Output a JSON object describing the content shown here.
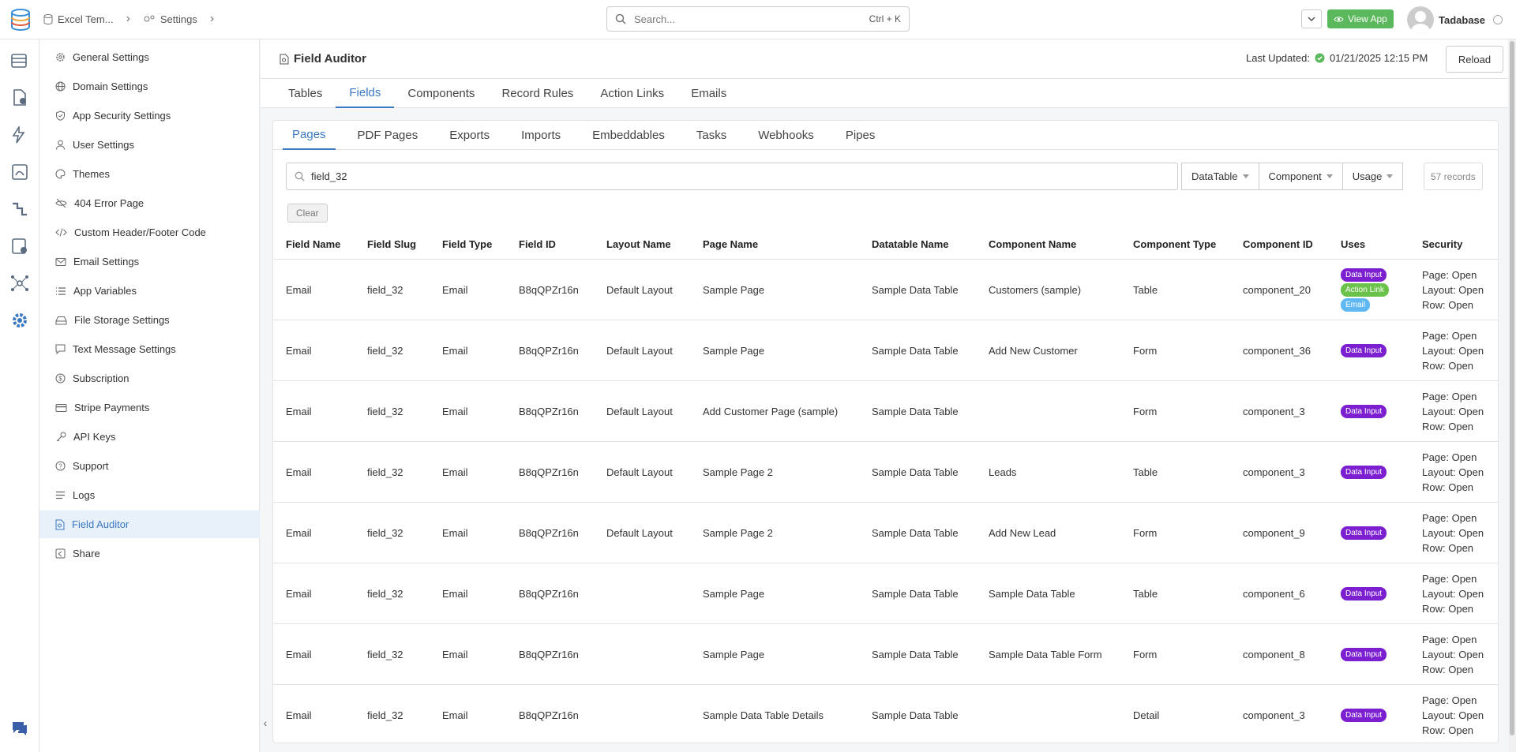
{
  "topbar": {
    "crumbs": [
      {
        "label": "Excel Tem..."
      },
      {
        "label": "Settings"
      }
    ],
    "search_placeholder": "Search...",
    "search_shortcut": "Ctrl + K",
    "view_app": "View App",
    "user_name": "Tadabase"
  },
  "sidebar": {
    "items": [
      {
        "label": "General Settings",
        "icon": "gear-icon"
      },
      {
        "label": "Domain Settings",
        "icon": "globe-icon"
      },
      {
        "label": "App Security Settings",
        "icon": "shield-icon"
      },
      {
        "label": "User Settings",
        "icon": "user-icon"
      },
      {
        "label": "Themes",
        "icon": "palette-icon"
      },
      {
        "label": "404 Error Page",
        "icon": "eye-slash-icon"
      },
      {
        "label": "Custom Header/Footer Code",
        "icon": "code-icon"
      },
      {
        "label": "Email Settings",
        "icon": "envelope-icon"
      },
      {
        "label": "App Variables",
        "icon": "list-icon"
      },
      {
        "label": "File Storage Settings",
        "icon": "hard-drive-icon"
      },
      {
        "label": "Text Message Settings",
        "icon": "chat-icon"
      },
      {
        "label": "Subscription",
        "icon": "dollar-icon"
      },
      {
        "label": "Stripe Payments",
        "icon": "credit-card-icon"
      },
      {
        "label": "API Keys",
        "icon": "key-icon"
      },
      {
        "label": "Support",
        "icon": "question-icon"
      },
      {
        "label": "Logs",
        "icon": "lines-icon"
      },
      {
        "label": "Field Auditor",
        "icon": "file-search-icon"
      },
      {
        "label": "Share",
        "icon": "share-icon"
      }
    ]
  },
  "header": {
    "title": "Field Auditor",
    "last_updated_label": "Last Updated:",
    "last_updated_value": "01/21/2025 12:15 PM",
    "reload": "Reload"
  },
  "tabs_primary": [
    "Tables",
    "Fields",
    "Components",
    "Record Rules",
    "Action Links",
    "Emails"
  ],
  "tabs_secondary": [
    "Pages",
    "PDF Pages",
    "Exports",
    "Imports",
    "Embeddables",
    "Tasks",
    "Webhooks",
    "Pipes"
  ],
  "filters": {
    "search_value": "field_32",
    "datatable": "DataTable",
    "component": "Component",
    "usage": "Usage",
    "records": "57 records",
    "clear": "Clear"
  },
  "table": {
    "columns": [
      "Field Name",
      "Field Slug",
      "Field Type",
      "Field ID",
      "Layout Name",
      "Page Name",
      "Datatable Name",
      "Component Name",
      "Component Type",
      "Component ID",
      "Uses",
      "Security"
    ],
    "rows": [
      {
        "field_name": "Email",
        "field_slug": "field_32",
        "field_type": "Email",
        "field_id": "B8qQPZr16n",
        "layout": "Default Layout",
        "page": "Sample Page",
        "datatable": "Sample Data Table",
        "component": "Customers (sample)",
        "comp_type": "Table",
        "comp_id": "component_20",
        "uses": [
          "Data Input",
          "Action Link",
          "Email"
        ],
        "sec": [
          "Page: Open",
          "Layout: Open",
          "Row: Open"
        ]
      },
      {
        "field_name": "Email",
        "field_slug": "field_32",
        "field_type": "Email",
        "field_id": "B8qQPZr16n",
        "layout": "Default Layout",
        "page": "Sample Page",
        "datatable": "Sample Data Table",
        "component": "Add New Customer",
        "comp_type": "Form",
        "comp_id": "component_36",
        "uses": [
          "Data Input"
        ],
        "sec": [
          "Page: Open",
          "Layout: Open",
          "Row: Open"
        ]
      },
      {
        "field_name": "Email",
        "field_slug": "field_32",
        "field_type": "Email",
        "field_id": "B8qQPZr16n",
        "layout": "Default Layout",
        "page": "Add Customer Page (sample)",
        "datatable": "Sample Data Table",
        "component": "",
        "comp_type": "Form",
        "comp_id": "component_3",
        "uses": [
          "Data Input"
        ],
        "sec": [
          "Page: Open",
          "Layout: Open",
          "Row: Open"
        ]
      },
      {
        "field_name": "Email",
        "field_slug": "field_32",
        "field_type": "Email",
        "field_id": "B8qQPZr16n",
        "layout": "Default Layout",
        "page": "Sample Page 2",
        "datatable": "Sample Data Table",
        "component": "Leads",
        "comp_type": "Table",
        "comp_id": "component_3",
        "uses": [
          "Data Input"
        ],
        "sec": [
          "Page: Open",
          "Layout: Open",
          "Row: Open"
        ]
      },
      {
        "field_name": "Email",
        "field_slug": "field_32",
        "field_type": "Email",
        "field_id": "B8qQPZr16n",
        "layout": "Default Layout",
        "page": "Sample Page 2",
        "datatable": "Sample Data Table",
        "component": "Add New Lead",
        "comp_type": "Form",
        "comp_id": "component_9",
        "uses": [
          "Data Input"
        ],
        "sec": [
          "Page: Open",
          "Layout: Open",
          "Row: Open"
        ]
      },
      {
        "field_name": "Email",
        "field_slug": "field_32",
        "field_type": "Email",
        "field_id": "B8qQPZr16n",
        "layout": "",
        "page": "Sample Page",
        "datatable": "Sample Data Table",
        "component": "Sample Data Table",
        "comp_type": "Table",
        "comp_id": "component_6",
        "uses": [
          "Data Input"
        ],
        "sec": [
          "Page: Open",
          "Layout: Open",
          "Row: Open"
        ]
      },
      {
        "field_name": "Email",
        "field_slug": "field_32",
        "field_type": "Email",
        "field_id": "B8qQPZr16n",
        "layout": "",
        "page": "Sample Page",
        "datatable": "Sample Data Table",
        "component": "Sample Data Table Form",
        "comp_type": "Form",
        "comp_id": "component_8",
        "uses": [
          "Data Input"
        ],
        "sec": [
          "Page: Open",
          "Layout: Open",
          "Row: Open"
        ]
      },
      {
        "field_name": "Email",
        "field_slug": "field_32",
        "field_type": "Email",
        "field_id": "B8qQPZr16n",
        "layout": "",
        "page": "Sample Data Table Details",
        "datatable": "Sample Data Table",
        "component": "",
        "comp_type": "Detail",
        "comp_id": "component_3",
        "uses": [
          "Data Input"
        ],
        "sec": [
          "Page: Open",
          "Layout: Open",
          "Row: Open"
        ]
      }
    ]
  },
  "colors": {
    "accent": "#3a78c2",
    "view_app": "#5cb85c",
    "badge_data_input": "#7b1fd1",
    "badge_action_link": "#6bc24a",
    "badge_email": "#5fb8f2"
  }
}
